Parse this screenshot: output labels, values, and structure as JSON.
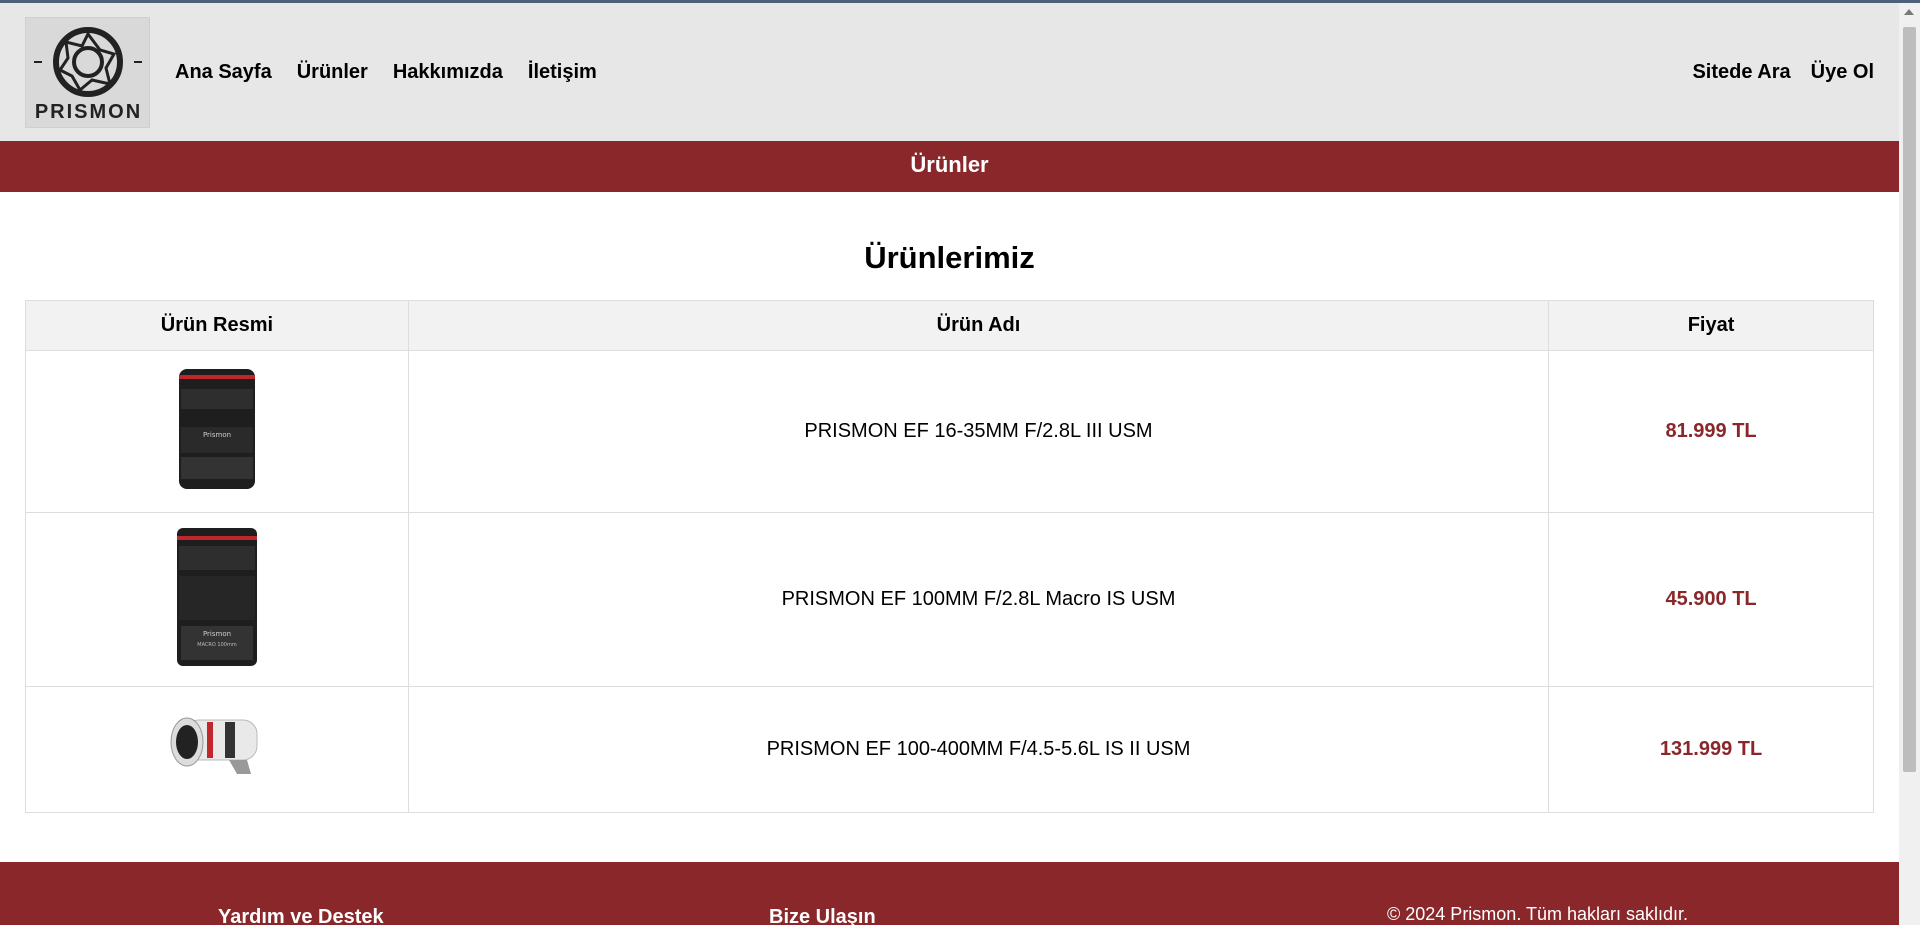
{
  "brand": {
    "name": "PRISMON"
  },
  "nav": {
    "items": [
      "Ana Sayfa",
      "Ürünler",
      "Hakkımızda",
      "İletişim"
    ]
  },
  "right_nav": {
    "search": "Sitede Ara",
    "signup": "Üye Ol"
  },
  "banner": {
    "title": "Ürünler"
  },
  "main": {
    "title": "Ürünlerimiz",
    "table": {
      "headers": [
        "Ürün Resmi",
        "Ürün Adı",
        "Fiyat"
      ],
      "rows": [
        {
          "name": "PRISMON EF 16-35MM F/2.8L III USM",
          "price": "81.999 TL"
        },
        {
          "name": "PRISMON EF 100MM F/2.8L Macro IS USM",
          "price": "45.900 TL"
        },
        {
          "name": "PRISMON EF 100-400MM F/4.5-5.6L IS II USM",
          "price": "131.999 TL"
        }
      ]
    }
  },
  "footer": {
    "help": "Yardım ve Destek",
    "contact": "Bize Ulaşın",
    "copyright": "© 2024 Prismon. Tüm hakları saklıdır."
  },
  "colors": {
    "accent": "#8a272a",
    "header_bg": "#e7e7e7"
  }
}
